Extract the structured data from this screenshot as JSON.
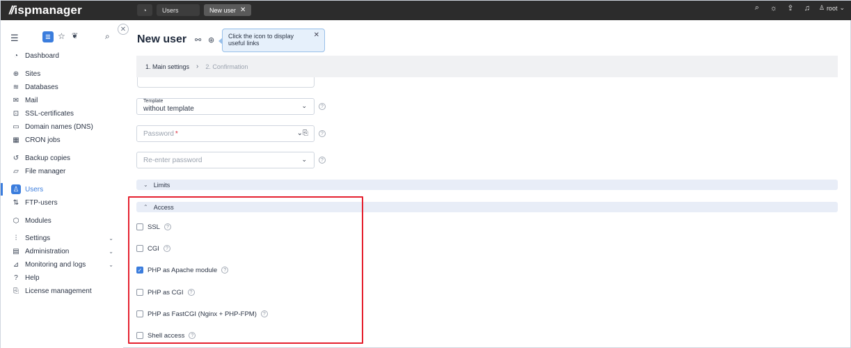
{
  "app": {
    "logo_text": "ispmanager"
  },
  "topbar": {
    "breadcrumbs": [
      {
        "label": "Users"
      },
      {
        "label": "New user"
      }
    ],
    "user_label": "root"
  },
  "sidebar": {
    "items": [
      {
        "label": "Dashboard",
        "icon": "dashboard-icon"
      },
      {
        "label": "Sites",
        "icon": "globe-icon"
      },
      {
        "label": "Databases",
        "icon": "database-icon"
      },
      {
        "label": "Mail",
        "icon": "mail-icon"
      },
      {
        "label": "SSL-certificates",
        "icon": "lock-icon"
      },
      {
        "label": "Domain names (DNS)",
        "icon": "dns-icon"
      },
      {
        "label": "CRON jobs",
        "icon": "calendar-icon"
      },
      {
        "label": "Backup copies",
        "icon": "restore-icon"
      },
      {
        "label": "File manager",
        "icon": "folder-icon"
      },
      {
        "label": "Users",
        "icon": "user-icon",
        "active": true
      },
      {
        "label": "FTP-users",
        "icon": "ftp-icon"
      },
      {
        "label": "Modules",
        "icon": "puzzle-icon"
      },
      {
        "label": "Settings",
        "icon": "sliders-icon"
      },
      {
        "label": "Administration",
        "icon": "server-icon"
      },
      {
        "label": "Monitoring and logs",
        "icon": "chart-icon"
      },
      {
        "label": "Help",
        "icon": "help-icon"
      },
      {
        "label": "License management",
        "icon": "license-icon"
      }
    ]
  },
  "main": {
    "title": "New user",
    "tooltip": "Click the icon to display useful links",
    "steps": [
      {
        "label": "1. Main settings"
      },
      {
        "label": "2. Confirmation"
      }
    ],
    "template": {
      "label": "Template",
      "value": "without template"
    },
    "password": {
      "placeholder": "Password"
    },
    "repassword": {
      "placeholder": "Re-enter password"
    },
    "sections": {
      "limits": "Limits",
      "access": "Access"
    },
    "access_options": [
      {
        "label": "SSL",
        "checked": false
      },
      {
        "label": "CGI",
        "checked": false
      },
      {
        "label": "PHP as Apache module",
        "checked": true
      },
      {
        "label": "PHP as CGI",
        "checked": false
      },
      {
        "label": "PHP as FastCGI (Nginx + PHP-FPM)",
        "checked": false
      },
      {
        "label": "Shell access",
        "checked": false
      }
    ]
  },
  "colors": {
    "accent": "#3b7ddd",
    "highlight": "#e5202e",
    "topbar": "#2c2c2c"
  }
}
